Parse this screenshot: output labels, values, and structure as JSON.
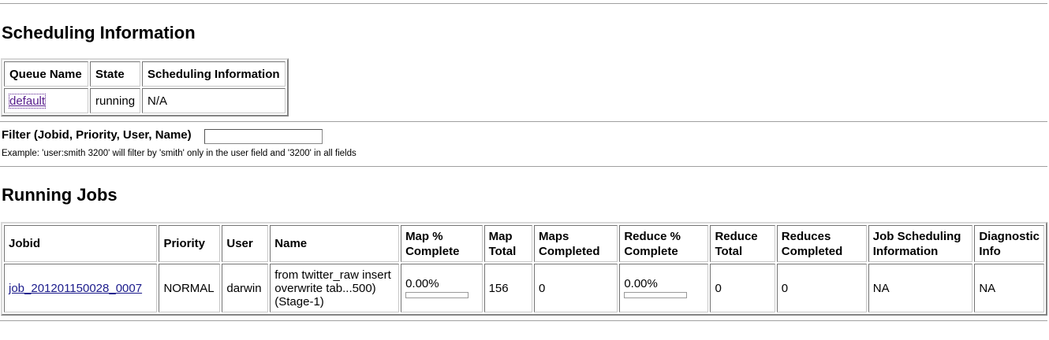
{
  "scheduling": {
    "title": "Scheduling Information",
    "headers": [
      "Queue Name",
      "State",
      "Scheduling Information"
    ],
    "row": {
      "queue": "default",
      "state": "running",
      "info": "N/A"
    }
  },
  "filter": {
    "label": "Filter (Jobid, Priority, User, Name)",
    "value": "",
    "example": "Example: 'user:smith 3200' will filter by 'smith' only in the user field and '3200' in all fields"
  },
  "running": {
    "title": "Running Jobs",
    "headers": {
      "jobid": "Jobid",
      "priority": "Priority",
      "user": "User",
      "name": "Name",
      "map_pct_1": "Map %",
      "map_pct_2": "Complete",
      "map_total_1": "Map",
      "map_total_2": "Total",
      "maps_completed_1": "Maps",
      "maps_completed_2": "Completed",
      "reduce_pct_1": "Reduce %",
      "reduce_pct_2": "Complete",
      "reduce_total_1": "Reduce",
      "reduce_total_2": "Total",
      "reduces_completed_1": "Reduces",
      "reduces_completed_2": "Completed",
      "job_sched_1": "Job Scheduling",
      "job_sched_2": "Information",
      "diag_1": "Diagnostic",
      "diag_2": "Info"
    },
    "jobs": [
      {
        "jobid": "job_201201150028_0007",
        "priority": "NORMAL",
        "user": "darwin",
        "name": "from twitter_raw insert overwrite tab...500)(Stage-1)",
        "map_pct": "0.00%",
        "map_progress": 0,
        "map_total": "156",
        "maps_completed": "0",
        "reduce_pct": "0.00%",
        "reduce_progress": 0,
        "reduce_total": "0",
        "reduces_completed": "0",
        "job_sched_info": "NA",
        "diagnostic": "NA"
      }
    ]
  }
}
